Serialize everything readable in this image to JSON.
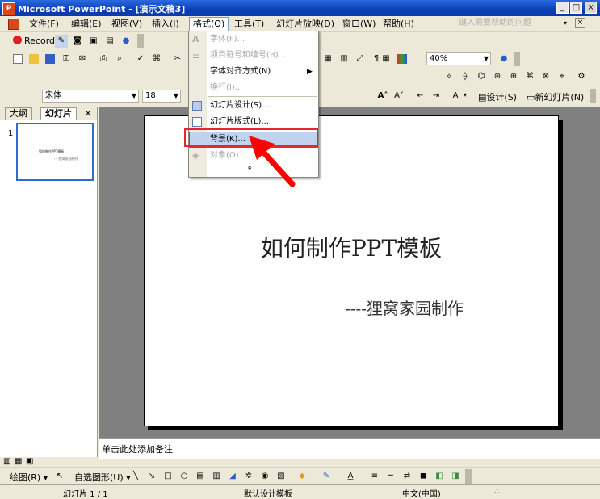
{
  "window": {
    "title": "Microsoft PowerPoint - [演示文稿3]"
  },
  "menubar": {
    "items": [
      "文件(F)",
      "编辑(E)",
      "视图(V)",
      "插入(I)",
      "格式(O)",
      "工具(T)",
      "幻灯片放映(D)",
      "窗口(W)",
      "帮助(H)"
    ],
    "active": "格式(O)",
    "help_search_placeholder": "键入需要帮助的问题"
  },
  "record_toolbar": {
    "record_label": "Record"
  },
  "standard_toolbar": {
    "zoom": "40%"
  },
  "formatting_toolbar": {
    "font_name": "宋体",
    "font_size": "18",
    "design_label": "设计(S)",
    "new_slide_label": "新幻灯片(N)"
  },
  "format_menu": {
    "items": [
      {
        "label": "字体(F)...",
        "disabled": true,
        "icon": "font-a-icon"
      },
      {
        "label": "项目符号和编号(B)...",
        "disabled": true,
        "icon": "bullets-icon"
      },
      {
        "label": "字体对齐方式(N)",
        "disabled": false,
        "icon": "",
        "submenu": true
      },
      {
        "label": "换行(I)...",
        "disabled": true,
        "icon": ""
      },
      {
        "label": "幻灯片设计(S)...",
        "disabled": false,
        "icon": "slide-design-icon"
      },
      {
        "label": "幻灯片版式(L)...",
        "disabled": false,
        "icon": "slide-layout-icon"
      },
      {
        "label": "背景(K)...",
        "disabled": false,
        "icon": "",
        "highlighted": true
      },
      {
        "label": "对象(O)...",
        "disabled": true,
        "icon": "object-icon"
      }
    ],
    "expand_glyph": "»"
  },
  "panes": {
    "tabs": [
      "大纲",
      "幻灯片"
    ],
    "close_glyph": "×",
    "thumbnail_number": "1",
    "notes_placeholder": "单击此处添加备注"
  },
  "slide": {
    "title": "如何制作PPT模板",
    "subtitle": "----狸窝家园制作"
  },
  "drawing_toolbar": {
    "draw_label": "绘图(R)",
    "autoshapes_label": "自选图形(U)"
  },
  "statusbar": {
    "slide_pos": "幻灯片 1 / 1",
    "design": "默认设计模板",
    "language": "中文(中国)"
  },
  "colors": {
    "titlebar": "#0a3fb8",
    "highlight_box": "#e8262a",
    "selection": "#c1d2ee"
  }
}
